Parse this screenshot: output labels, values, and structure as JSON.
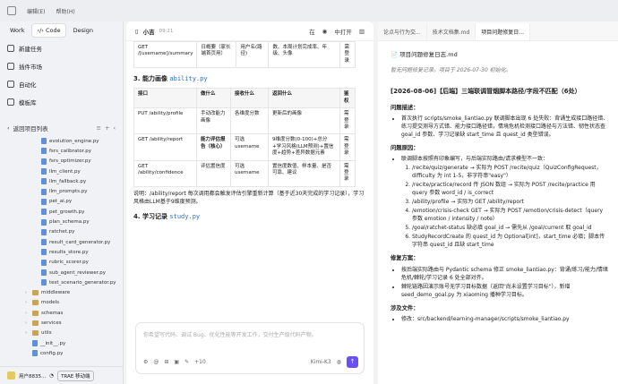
{
  "topbar": {
    "menu": [
      "编辑(E)",
      "帮助(H)"
    ]
  },
  "sidebar": {
    "modes": [
      "Work",
      "Code",
      "Design"
    ],
    "nav": [
      "新建任务",
      "插件市场",
      "自动化",
      "模板库"
    ],
    "tree_title": "返回项目列表",
    "tree": [
      {
        "name": "evolution_engine.py",
        "type": "file",
        "indent": 3
      },
      {
        "name": "fsrs_calibrator.py",
        "type": "file",
        "indent": 3
      },
      {
        "name": "fsrs_optimizer.py",
        "type": "file",
        "indent": 3
      },
      {
        "name": "llm_client.py",
        "type": "file",
        "indent": 3
      },
      {
        "name": "llm_fallback.py",
        "type": "file",
        "indent": 3
      },
      {
        "name": "llm_prompts.py",
        "type": "file",
        "indent": 3
      },
      {
        "name": "pet_ai.py",
        "type": "file",
        "indent": 3
      },
      {
        "name": "pet_growth.py",
        "type": "file",
        "indent": 3
      },
      {
        "name": "plan_schema.py",
        "type": "file",
        "indent": 3
      },
      {
        "name": "ratchet.py",
        "type": "file",
        "indent": 3
      },
      {
        "name": "result_card_generator.py",
        "type": "file",
        "indent": 3
      },
      {
        "name": "results_store.py",
        "type": "file",
        "indent": 3
      },
      {
        "name": "rubric_scorer.py",
        "type": "file",
        "indent": 3
      },
      {
        "name": "sub_agent_reviewer.py",
        "type": "file",
        "indent": 3
      },
      {
        "name": "test_scenario_generator.py",
        "type": "file",
        "indent": 3
      },
      {
        "name": "middleware",
        "type": "dir",
        "indent": 2
      },
      {
        "name": "models",
        "type": "dir",
        "indent": 2
      },
      {
        "name": "schemas",
        "type": "dir",
        "indent": 2
      },
      {
        "name": "services",
        "type": "dir",
        "indent": 2
      },
      {
        "name": "utils",
        "type": "dir",
        "indent": 2
      },
      {
        "name": "__init__.py",
        "type": "file",
        "indent": 2
      },
      {
        "name": "config.py",
        "type": "file",
        "indent": 2
      }
    ],
    "user": "用户8835...",
    "badge": "TRAE 移动端"
  },
  "chat": {
    "agent": "小吉",
    "time": "09:21",
    "toolbar": [
      "在",
      "中打开"
    ],
    "table1_row": {
      "api": "GET /[username]/summary",
      "name": "日概要（家长端首页用）",
      "params": "用户名(路径)",
      "returns": "数、本周计划完成率、年级、头像",
      "auth": "需登录"
    },
    "section3": {
      "num": "3. 能力画像",
      "file": "ability.py"
    },
    "headers": [
      "接口",
      "做什么",
      "接收什么",
      "返回什么",
      "鉴权"
    ],
    "rows": [
      {
        "api": "PUT /ability/profile",
        "what": "手动改能力画像",
        "params": "各维度分数",
        "returns": "更新后的画像",
        "auth": "需登录"
      },
      {
        "api": "GET /ability/report",
        "what": "能力评估报告（核心）",
        "params": "可选 username",
        "returns": "9维度分数(0-100)+总分+学习风格(LLM预测)+置信度+趋势+差异数据元素",
        "auth": "需登录"
      },
      {
        "api": "GET /ability/confidence",
        "what": "评估置信度",
        "params": "可选 username",
        "returns": "置信度数值、样本量、是否可靠、建议",
        "auth": "需登录"
      }
    ],
    "note": "说明：/ability/report 每次调用都会触发评估引擎重新计算（基于近30天完成的学习记录），学习风格由LLM基于9维度预测。",
    "section4": {
      "num": "4. 学习记录",
      "file": "study.py"
    },
    "input_placeholder": "你希望写代码、调试 Bug、优化性能等开发工作，交付生产级代码产物。",
    "count": "+10",
    "model": "Kimi-K3"
  },
  "doc": {
    "tabs": [
      "论点与行为交...",
      "技术文档集.md",
      "项目问题修复日..."
    ],
    "title": "项目问题修复日志.md",
    "meta": "暂无问题修复记录。项目于 2026-07-30 初始化。",
    "entry_title": "[2026-08-06]【后端】三端联调冒烟脚本路径/字段不匹配（6处）",
    "problem_h": "问题描述：",
    "problem": "首次执行 scripts/smoke_liantiao.py 联调脚本出现 6 处失败：背诵生成接口路径错、练习提交测导方式错、能力接口路径错，情境危机检测接口路径与方法错、韧性状态查 goal_id 参数、学习记录缺 start_time 且 quest_id 类型错误。",
    "cause_h": "问题原因：",
    "cause_intro": "联调脚本按照有印象编写，与后端实际路由/请求模型不一致：",
    "causes": [
      "/recite/quiz/generate → 实际为 POST /recite/quiz（QuizConfigRequest，difficulty 为 int 1-5，非字符串\"easy\"）",
      "/recite/practice/record 传 JSON 数组 → 实际为 POST /recite/practice 用 query 参数 word_id / is_correct",
      "/ability/profile → 实际为 GET /ability/report",
      "/emotion/crisis-check GET → 实际为 POST /emotion/crisis-detect（query 参数 emotion / intensity / note）",
      "/goal/ratchet-status 缺必填 goal_id → 需先从 /goal/current 取 goal_id",
      "StudyRecordCreate 的 quest_id 为 Optional[int]，start_time 必填；脚本传字符串 quest_id 且缺 start_time"
    ],
    "fix_h": "修复方案：",
    "fixes": [
      "按后端实际路由与 Pydantic schema 修正 smoke_liantiao.py：背诵/练习/能力/情绪危机/棘轮/学习记录 6 处全部对齐。",
      "棘轮链路因演示账号无学习目标数据（返回\"尚未设置学习目标\"），新增 seed_demo_goal.py 为 xiaoming 播种学习目标。"
    ],
    "files_h": "涉及文件：",
    "files": "修改：src/backend/learning-manager/scripts/smoke_liantiao.py"
  }
}
